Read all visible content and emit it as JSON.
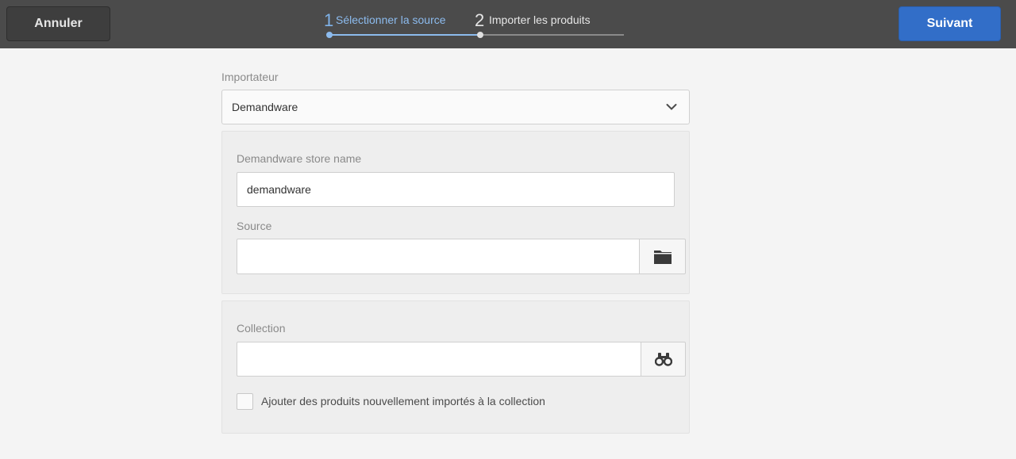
{
  "toolbar": {
    "cancel_label": "Annuler",
    "next_label": "Suivant",
    "accent_color": "#326ec8"
  },
  "wizard": {
    "steps": [
      {
        "number": "1",
        "label": "Sélectionner la source",
        "state": "active"
      },
      {
        "number": "2",
        "label": "Importer les produits",
        "state": "pending"
      }
    ]
  },
  "form": {
    "importer": {
      "label": "Importateur",
      "selected": "Demandware",
      "icon": "chevron-down-icon"
    },
    "store_name": {
      "label": "Demandware store name",
      "value": "demandware"
    },
    "source": {
      "label": "Source",
      "value": "",
      "icon": "folder-icon"
    },
    "collection": {
      "label": "Collection",
      "value": "",
      "icon": "binoculars-icon"
    },
    "add_to_collection": {
      "label": "Ajouter des produits nouvellement importés à la collection",
      "checked": false
    }
  }
}
